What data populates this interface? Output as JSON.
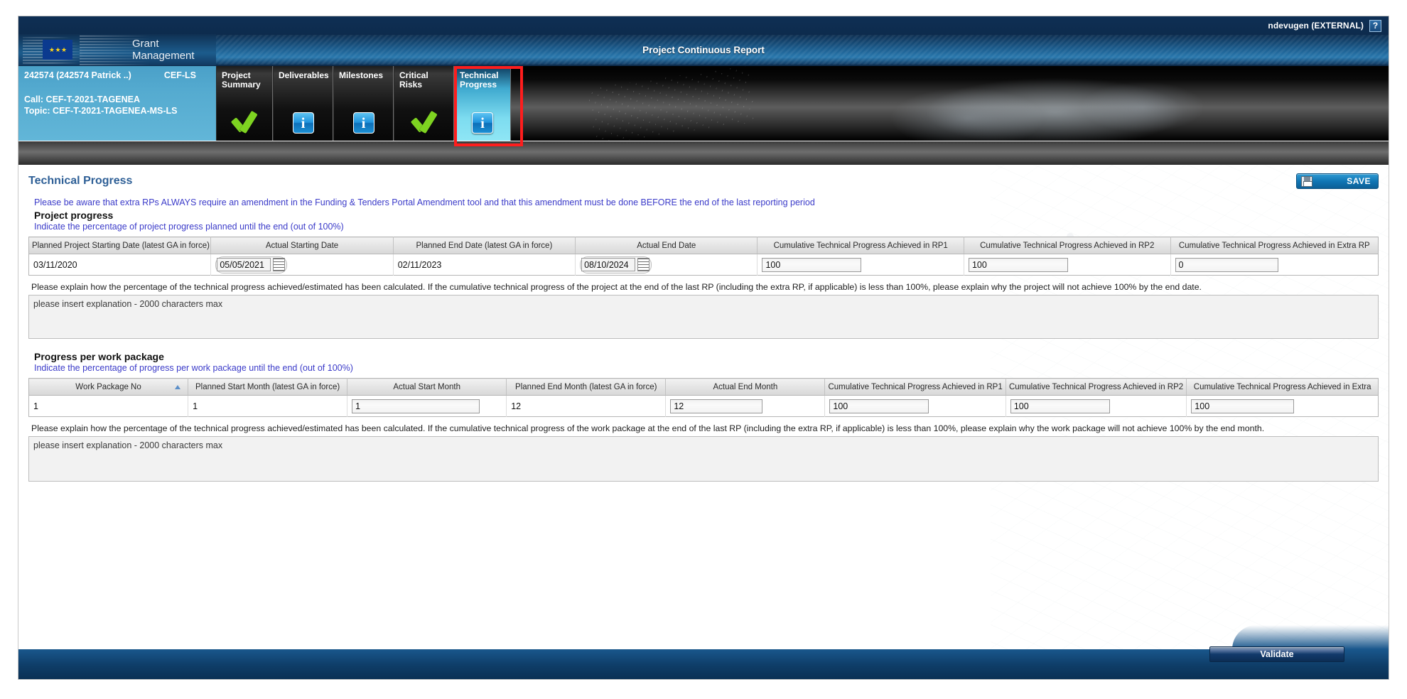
{
  "topbar": {
    "username": "ndevugen (EXTERNAL)",
    "help_label": "?"
  },
  "brand": {
    "line1": "Grant",
    "line2": "Management",
    "report_title": "Project Continuous Report"
  },
  "project": {
    "id_line": "242574 (242574 Patrick ..)",
    "programme": "CEF-LS",
    "call": "Call: CEF-T-2021-TAGENEA",
    "topic": "Topic: CEF-T-2021-TAGENEA-MS-LS"
  },
  "tabs": [
    {
      "label_l1": "Project",
      "label_l2": "Summary",
      "icon": "green-check-icon",
      "active": false
    },
    {
      "label_l1": "Deliverables",
      "label_l2": "",
      "icon": "blue-info-icon",
      "active": false
    },
    {
      "label_l1": "Milestones",
      "label_l2": "",
      "icon": "blue-info-icon",
      "active": false
    },
    {
      "label_l1": "Critical Risks",
      "label_l2": "",
      "icon": "green-check-icon",
      "active": false
    },
    {
      "label_l1": "Technical",
      "label_l2": "Progress",
      "icon": "blue-info-icon",
      "active": true
    }
  ],
  "page": {
    "title": "Technical Progress",
    "save_label": "SAVE",
    "validate_label": "Validate"
  },
  "notice": "Please be aware that extra RPs ALWAYS require an amendment in the Funding & Tenders Portal Amendment tool and that this amendment must be done BEFORE the end of the last reporting period",
  "project_progress": {
    "heading": "Project progress",
    "subheading": "Indicate the percentage of project progress planned until the end (out of 100%)",
    "columns": [
      "Planned Project Starting Date (latest GA in force)",
      "Actual Starting Date",
      "Planned End Date (latest GA in force)",
      "Actual End Date",
      "Cumulative Technical Progress Achieved in RP1",
      "Cumulative Technical Progress Achieved in RP2",
      "Cumulative Technical Progress Achieved in Extra RP"
    ],
    "row": {
      "planned_start": "03/11/2020",
      "actual_start": "05/05/2021",
      "planned_end": "02/11/2023",
      "actual_end": "08/10/2024",
      "rp1": "100",
      "rp2": "100",
      "extra_rp": "0"
    },
    "explain_label": "Please explain how the percentage of the technical progress achieved/estimated has been calculated. If the cumulative technical progress of the project at the end of the last RP (including the extra RP, if applicable) is less than 100%, please explain why the project will not achieve 100% by the end date.",
    "explain_value": "please insert explanation - 2000 characters max"
  },
  "work_package_progress": {
    "heading": "Progress per work package",
    "subheading": "Indicate the percentage of progress per work package until the end (out of 100%)",
    "columns": [
      "Work Package No",
      "Planned Start Month (latest GA in force)",
      "Actual Start Month",
      "Planned End Month (latest GA in force)",
      "Actual End Month",
      "Cumulative Technical Progress Achieved in RP1",
      "Cumulative Technical Progress Achieved in RP2",
      "Cumulative Technical Progress Achieved in Extra"
    ],
    "sorted_column": "Work Package No",
    "sort_direction": "ascending",
    "row": {
      "wp_no": "1",
      "planned_start_month": "1",
      "actual_start_month": "1",
      "planned_end_month": "12",
      "actual_end_month": "12",
      "rp1": "100",
      "rp2": "100",
      "extra_rp": "100"
    },
    "explain_label": "Please explain how the percentage of the technical progress achieved/estimated has been calculated. If the cumulative technical progress of the work package at the end of the last RP (including the extra RP, if applicable) is less than 100%, please explain why the work package will not achieve 100% by the end month.",
    "explain_value": "please insert explanation - 2000 characters max"
  },
  "colors": {
    "accent_blue": "#2e5f96",
    "link_blue": "#3b3bc9",
    "highlight_red": "#ff1d1d",
    "tab_active": "#7ddcf0"
  }
}
